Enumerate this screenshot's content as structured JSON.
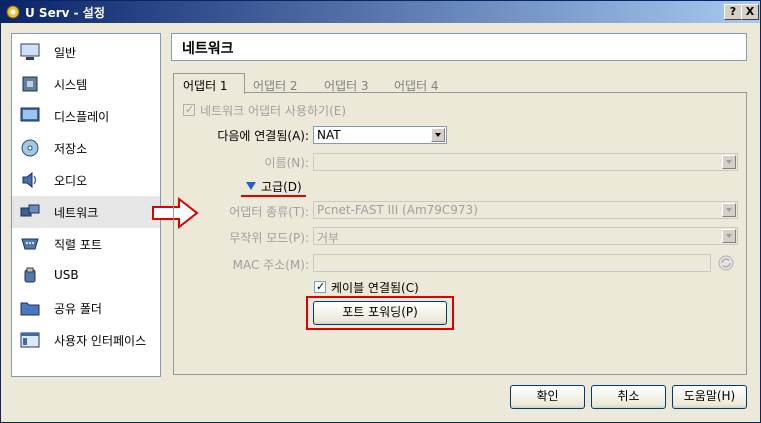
{
  "window": {
    "title": "U Serv - 설정",
    "help_btn": "?",
    "close_btn": "X"
  },
  "sidebar": {
    "items": [
      {
        "label": "일반",
        "icon": "monitor-icon"
      },
      {
        "label": "시스템",
        "icon": "chip-icon"
      },
      {
        "label": "디스플레이",
        "icon": "display-icon"
      },
      {
        "label": "저장소",
        "icon": "disk-icon"
      },
      {
        "label": "오디오",
        "icon": "speaker-icon"
      },
      {
        "label": "네트워크",
        "icon": "network-icon",
        "selected": true
      },
      {
        "label": "직렬 포트",
        "icon": "serial-port-icon"
      },
      {
        "label": "USB",
        "icon": "usb-icon"
      },
      {
        "label": "공유 폴더",
        "icon": "folder-icon"
      },
      {
        "label": "사용자 인터페이스",
        "icon": "window-icon"
      }
    ]
  },
  "page_title": "네트워크",
  "tabs": [
    "어댑터 1",
    "어댑터 2",
    "어댑터 3",
    "어댑터 4"
  ],
  "adapter": {
    "enable_label": "네트워크 어댑터 사용하기(E)",
    "attached_label": "다음에 연결됨(A):",
    "attached_value": "NAT",
    "name_label": "이름(N):",
    "name_value": "",
    "advanced_label": "고급(D)",
    "adapter_type_label": "어댑터 종류(T):",
    "adapter_type_value": "Pcnet-FAST III (Am79C973)",
    "promisc_label": "무작위 모드(P):",
    "promisc_value": "거부",
    "mac_label": "MAC 주소(M):",
    "mac_value": "",
    "cable_label": "케이블 연결됨(C)",
    "port_forward_label": "포트 포워딩(P)"
  },
  "footer": {
    "ok": "확인",
    "cancel": "취소",
    "help": "도움말(H)"
  },
  "colors": {
    "annotation": "#e00000",
    "titlebar": "#0a246a",
    "selected_row": "#e6e6e6"
  }
}
